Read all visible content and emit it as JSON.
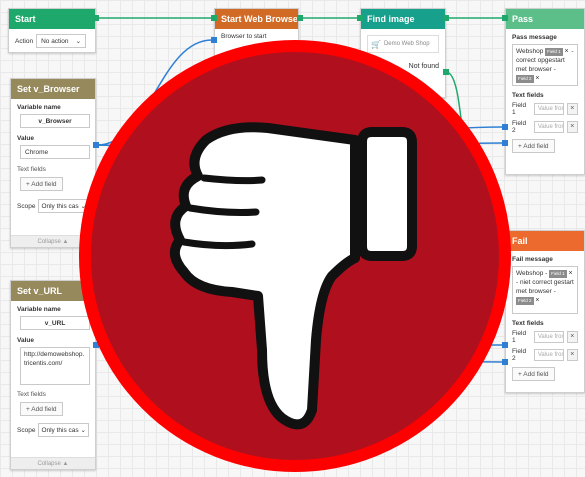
{
  "colors": {
    "start_header": "#1fa86c",
    "browser_header": "#d06a25",
    "find_header": "#17a08b",
    "pass_header": "#5cbf8a",
    "fail_header": "#ec6a2e",
    "variable_header": "#968a5d",
    "wire_green": "#1fa86c",
    "wire_blue": "#2f7fd4",
    "thumb_circle": "#b0101e",
    "thumb_ring": "#ff0000"
  },
  "start": {
    "title": "Start",
    "action_label": "Action",
    "action_value": "No action"
  },
  "browser": {
    "title": "Start Web Browser",
    "browser_label": "Browser to start"
  },
  "find": {
    "title": "Find image",
    "image_caption": "Demo Web Shop",
    "not_found": "Not found"
  },
  "pass": {
    "title": "Pass",
    "message_label": "Pass message",
    "message": {
      "prefix": "Webshop",
      "chip1": "Field 1",
      "middle": "- correct opgestart met browser -",
      "chip2": "Field 2"
    },
    "text_fields_label": "Text fields",
    "fields": [
      {
        "label": "Field 1",
        "placeholder": "Value from"
      },
      {
        "label": "Field 2",
        "placeholder": "Value from"
      }
    ],
    "add_field": "Add field"
  },
  "fail": {
    "title": "Fail",
    "message_label": "Fail message",
    "message": {
      "prefix": "Webshop -",
      "chip1": "Field 1",
      "middle": "- niet correct gestart met browser -",
      "chip2": "Field 2"
    },
    "text_fields_label": "Text fields",
    "fields": [
      {
        "label": "Field 1",
        "placeholder": "Value from"
      },
      {
        "label": "Field 2",
        "placeholder": "Value from"
      }
    ],
    "add_field": "Add field"
  },
  "set_browser": {
    "title": "Set v_Browser",
    "variable_name_label": "Variable name",
    "variable_name": "v_Browser",
    "value_label": "Value",
    "value": "Chrome",
    "text_fields_label": "Text fields",
    "add_field": "Add field",
    "scope_label": "Scope",
    "scope_value": "Only this cas",
    "collapse": "Collapse"
  },
  "set_url": {
    "title": "Set v_URL",
    "variable_name_label": "Variable name",
    "variable_name": "v_URL",
    "value_label": "Value",
    "value": "http://demowebshop.tricentis.com/",
    "text_fields_label": "Text fields",
    "add_field": "Add field",
    "scope_label": "Scope",
    "scope_value": "Only this cas",
    "collapse": "Collapse"
  }
}
